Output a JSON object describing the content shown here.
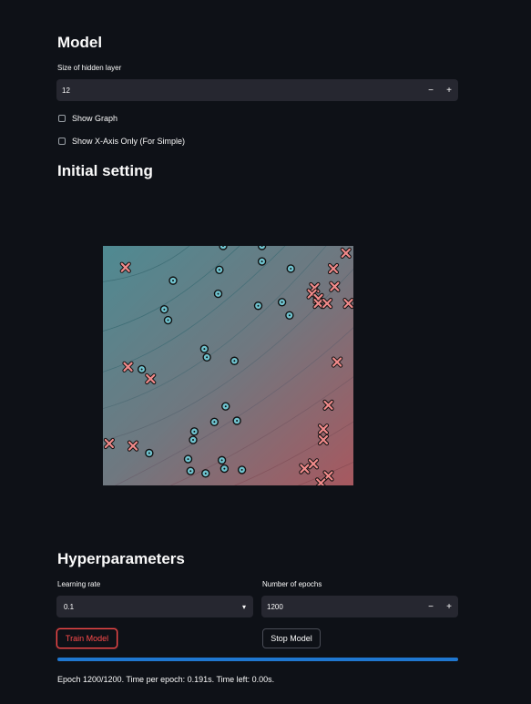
{
  "model": {
    "heading": "Model",
    "hidden_layer_label": "Size of hidden layer",
    "hidden_layer_value": "12",
    "minus": "−",
    "plus": "+",
    "show_graph_label": "Show Graph",
    "show_x_axis_label": "Show X-Axis Only (For Simple)"
  },
  "initial": {
    "heading": "Initial setting"
  },
  "hyper": {
    "heading": "Hyperparameters",
    "learning_rate_label": "Learning rate",
    "learning_rate_value": "0.1",
    "epochs_label": "Number of epochs",
    "epochs_value": "1200",
    "minus": "−",
    "plus": "+",
    "chevron": "▾"
  },
  "buttons": {
    "train": "Train Model",
    "stop": "Stop Model"
  },
  "progress": {
    "fraction": 1.0,
    "status": "Epoch 1200/1200. Time per epoch: 0.191s. Time left: 0.00s."
  },
  "colors": {
    "accent": "#ff4b4b",
    "progress": "#1f77d0",
    "class_o": "#6fc3cf",
    "class_x": "#f08a8a"
  },
  "chart_data": {
    "type": "scatter",
    "title": "",
    "xlabel": "",
    "ylabel": "",
    "xlim": [
      -1,
      1
    ],
    "ylim": [
      -1,
      1
    ],
    "series": [
      {
        "marker": "o",
        "points": [
          [
            -0.04,
            1.0
          ],
          [
            0.27,
            1.0
          ],
          [
            0.27,
            0.87
          ],
          [
            -0.07,
            0.8
          ],
          [
            0.5,
            0.81
          ],
          [
            -0.44,
            0.71
          ],
          [
            -0.08,
            0.6
          ],
          [
            0.24,
            0.5
          ],
          [
            0.43,
            0.53
          ],
          [
            0.49,
            0.42
          ],
          [
            -0.51,
            0.47
          ],
          [
            -0.48,
            0.38
          ],
          [
            -0.19,
            0.14
          ],
          [
            -0.17,
            0.07
          ],
          [
            0.05,
            0.04
          ],
          [
            -0.69,
            -0.03
          ],
          [
            -0.02,
            -0.34
          ],
          [
            0.07,
            -0.46
          ],
          [
            -0.11,
            -0.47
          ],
          [
            -0.27,
            -0.55
          ],
          [
            -0.28,
            -0.62
          ],
          [
            -0.63,
            -0.73
          ],
          [
            -0.32,
            -0.78
          ],
          [
            -0.05,
            -0.79
          ],
          [
            -0.3,
            -0.88
          ],
          [
            -0.18,
            -0.9
          ],
          [
            -0.03,
            -0.86
          ],
          [
            0.11,
            -0.87
          ]
        ]
      },
      {
        "marker": "x",
        "points": [
          [
            0.94,
            0.94
          ],
          [
            -0.82,
            0.82
          ],
          [
            0.84,
            0.81
          ],
          [
            0.69,
            0.65
          ],
          [
            0.85,
            0.66
          ],
          [
            0.67,
            0.6
          ],
          [
            0.72,
            0.56
          ],
          [
            0.72,
            0.52
          ],
          [
            0.79,
            0.52
          ],
          [
            0.96,
            0.52
          ],
          [
            0.87,
            0.03
          ],
          [
            -0.8,
            -0.01
          ],
          [
            -0.62,
            -0.11
          ],
          [
            0.8,
            -0.33
          ],
          [
            0.76,
            -0.53
          ],
          [
            0.76,
            -0.62
          ],
          [
            -0.95,
            -0.65
          ],
          [
            -0.76,
            -0.67
          ],
          [
            0.68,
            -0.82
          ],
          [
            0.61,
            -0.86
          ],
          [
            0.8,
            -0.92
          ],
          [
            0.74,
            -0.98
          ]
        ]
      }
    ]
  }
}
